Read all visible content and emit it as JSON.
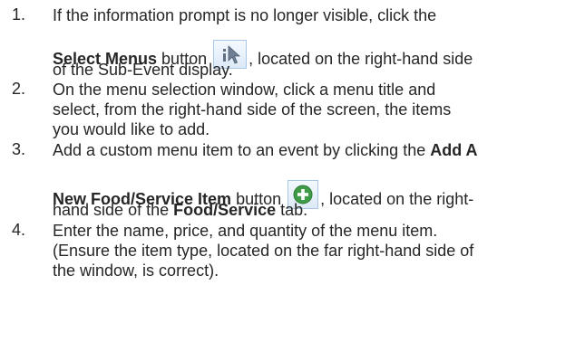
{
  "steps": [
    {
      "number": "1.",
      "lines": [
        {
          "text": "If the information prompt is no longer visible, click the"
        },
        {
          "bold1": "Select Menus",
          "text1": " button ",
          "text2": ", located on the right-hand side"
        },
        {
          "text": "of the Sub-Event display."
        }
      ],
      "icon": "select-menus-icon"
    },
    {
      "number": "2.",
      "lines": [
        {
          "text": "On the menu selection window, click a menu title and"
        },
        {
          "text": "select, from the right-hand side of the screen, the items"
        },
        {
          "text": "you would like to add."
        }
      ]
    },
    {
      "number": "3.",
      "lines": [
        {
          "text1": "Add a custom menu item to an event by clicking the ",
          "bold1": "Add A"
        },
        {
          "bold1": "New Food/Service Item",
          "text1": " button ",
          "text2": ", located on the right-"
        },
        {
          "text1": "hand side of the ",
          "bold1": "Food/Service",
          "text2": " tab."
        }
      ],
      "icon": "add-item-plus-icon",
      "colors": {
        "icon_green": "#3f9b47"
      }
    },
    {
      "number": "4.",
      "lines": [
        {
          "text": "Enter the name, price, and quantity of the menu item."
        },
        {
          "text": "(Ensure the item type, located on the far right-hand side of"
        },
        {
          "text": "the window, is correct)."
        }
      ]
    }
  ]
}
